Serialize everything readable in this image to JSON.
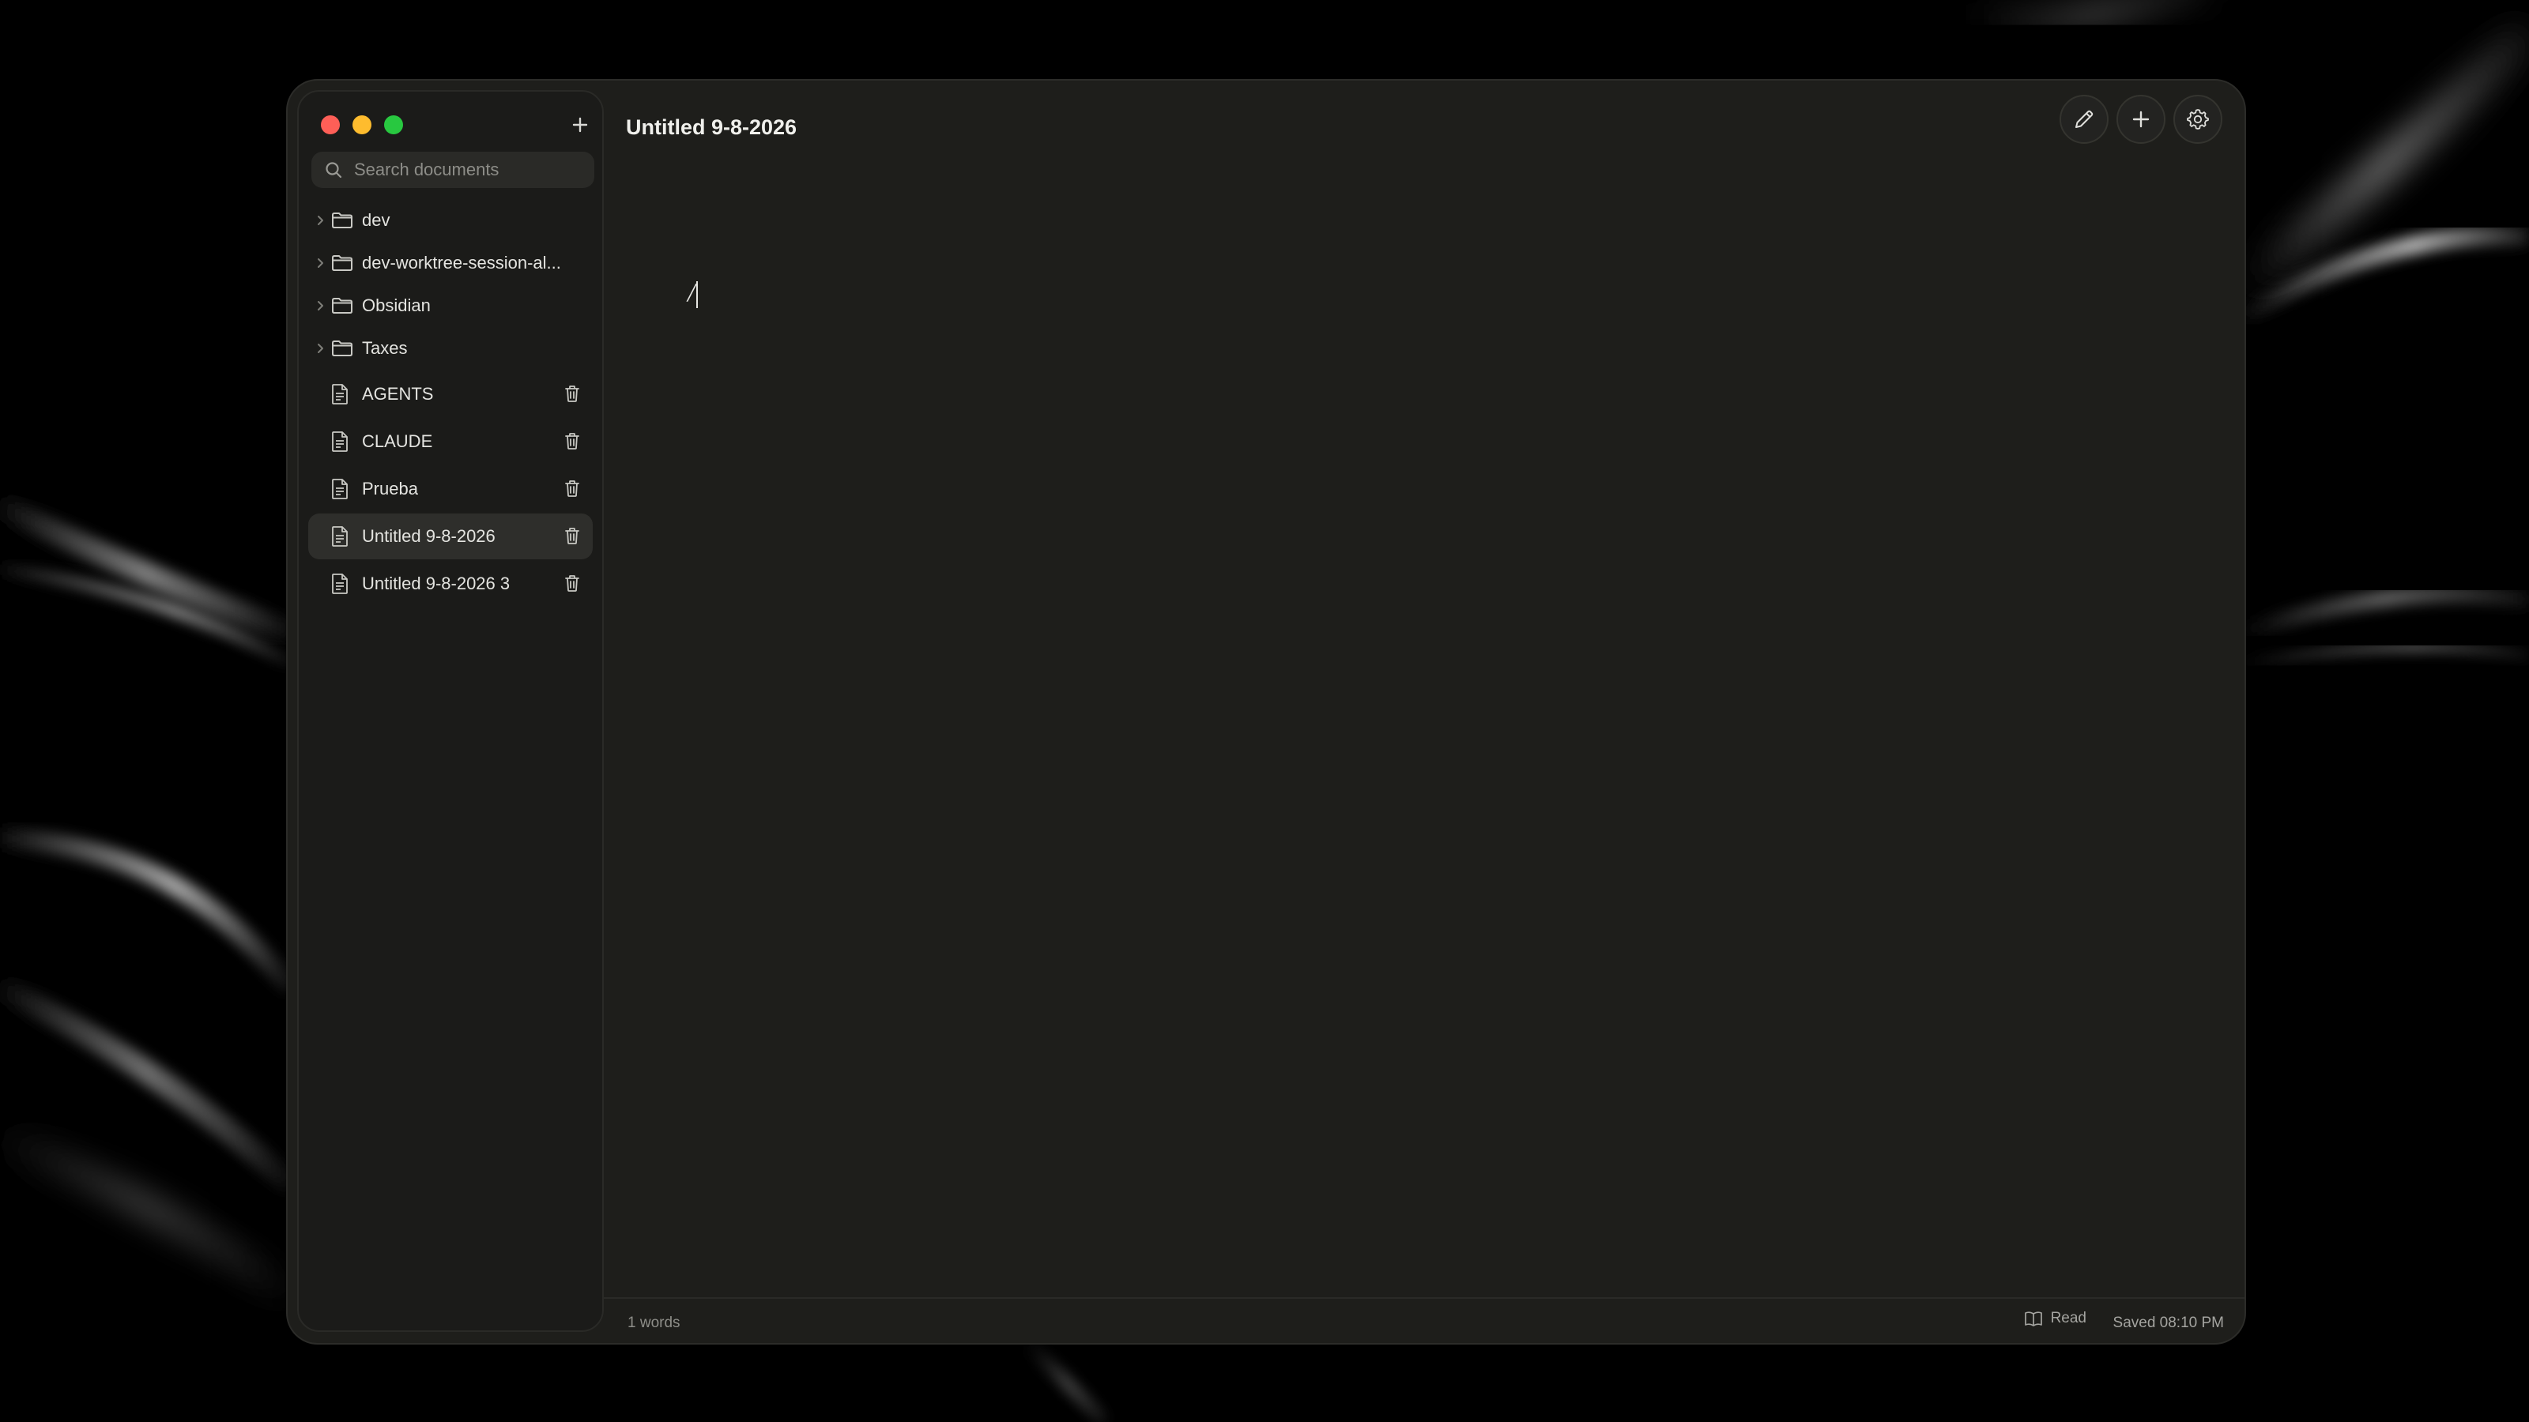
{
  "sidebar": {
    "search_placeholder": "Search documents",
    "folders": [
      {
        "label": "dev",
        "icon": "folder-icon"
      },
      {
        "label": "dev-worktree-session-al...",
        "icon": "folder-icon"
      },
      {
        "label": "Obsidian",
        "icon": "folder-icon"
      },
      {
        "label": "Taxes",
        "icon": "folder-icon"
      }
    ],
    "files": [
      {
        "label": "AGENTS",
        "icon": "document-icon",
        "active": false
      },
      {
        "label": "CLAUDE",
        "icon": "document-icon",
        "active": false
      },
      {
        "label": "Prueba",
        "icon": "document-icon",
        "active": false
      },
      {
        "label": "Untitled 9-8-2026",
        "icon": "document-icon",
        "active": true
      },
      {
        "label": "Untitled 9-8-2026 3",
        "icon": "document-icon",
        "active": false
      }
    ]
  },
  "header": {
    "title": "Untitled 9-8-2026",
    "buttons": [
      "pencil-icon",
      "plus-icon",
      "gear-icon"
    ]
  },
  "editor": {
    "content": "/"
  },
  "footer": {
    "word_count": "1 words",
    "read_label": "Read",
    "saved": "Saved 08:10 PM"
  },
  "colors": {
    "window_bg": "#1e1e1b",
    "sidebar_bg": "#1b1b19",
    "active_item_bg": "#2e2e2b",
    "traffic_close": "#fe5f57",
    "traffic_minimize": "#febc2e",
    "traffic_maximize": "#28c840"
  }
}
